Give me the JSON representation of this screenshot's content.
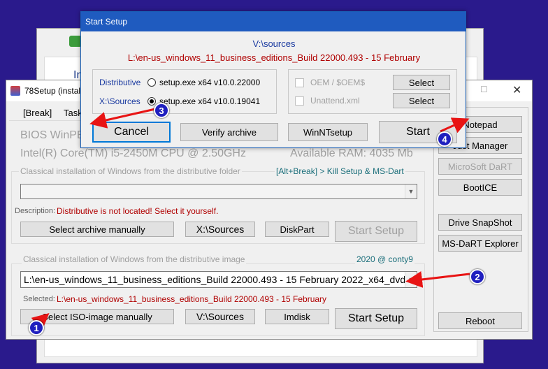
{
  "background_window": {
    "title_partial": "In"
  },
  "main_window": {
    "title": "78Setup (install",
    "tabs": [
      "[Break]",
      "Task"
    ],
    "bios_text": "BIOS WinPE",
    "cpu_text": "Intel(R) Core(TM) i5-2450M CPU @ 2.50GHz",
    "ram_text": "Available RAM: 4035 Mb",
    "group1": {
      "label": "Classical installation of Windows from the distributive folder",
      "hint": "[Alt+Break] > Kill Setup & MS-Dart",
      "description_label": "Description:",
      "description_text": "Distributive is not located! Select it yourself.",
      "buttons": {
        "select_archive": "Select archive manually",
        "x_sources": "X:\\Sources",
        "diskpart": "DiskPart",
        "start_setup": "Start Setup"
      }
    },
    "group2": {
      "label": "Classical installation of Windows from the distributive image",
      "credit": "2020 @ conty9",
      "combo_value": "L:\\en-us_windows_11_business_editions_Build 22000.493 - 15 February 2022_x64_dvd_",
      "selected_label": "Selected:",
      "selected_text": "L:\\en-us_windows_11_business_editions_Build 22000.493 - 15 February",
      "buttons": {
        "select_iso": "Select ISO-image manually",
        "v_sources": "V:\\Sources",
        "imdisk": "Imdisk",
        "start_setup": "Start Setup"
      }
    },
    "side_buttons": {
      "notepad": "Notepad",
      "just_manager": "Just Manager",
      "dart": "MicroSoft DaRT",
      "bootice": "BootICE",
      "snapshot": "Drive SnapShot",
      "msdart": "MS-DaRT Explorer",
      "reboot": "Reboot"
    }
  },
  "dialog": {
    "title": "Start Setup",
    "sources_path": "V:\\sources",
    "image_name": "L:\\en-us_windows_11_business_editions_Build 22000.493 - 15 February",
    "distributive_label": "Distributive",
    "distributive_option": "setup.exe x64 v10.0.22000",
    "xsources_label": "X:\\Sources",
    "xsources_option": "setup.exe x64 v10.0.19041",
    "oem_label": "OEM / $OEM$",
    "unattend_label": "Unattend.xml",
    "select_label": "Select",
    "cancel": "Cancel",
    "verify": "Verify archive",
    "winnt": "WinNTsetup",
    "start": "Start"
  },
  "annotations": {
    "badges": [
      "1",
      "2",
      "3",
      "4"
    ],
    "color_arrow": "#e81414",
    "color_badge": "#1f1fbf"
  }
}
